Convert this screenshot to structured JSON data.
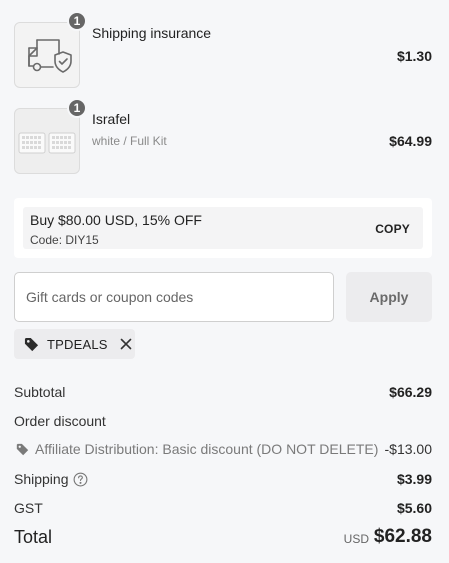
{
  "line_items": [
    {
      "name": "Shipping insurance",
      "variant": "",
      "price": "$1.30",
      "quantity": "1",
      "icon": "shipping-truck-shield-icon"
    },
    {
      "name": "Israfel",
      "variant": "white / Full Kit",
      "price": "$64.99",
      "quantity": "1",
      "icon": "product-thumbnail"
    }
  ],
  "offer": {
    "title": "Buy $80.00 USD, 15% OFF",
    "code_text": "Code: DIY15",
    "copy_label": "COPY"
  },
  "coupon": {
    "placeholder": "Gift cards or coupon codes",
    "value": "",
    "apply_label": "Apply"
  },
  "applied_tag": {
    "label": "TPDEALS",
    "icon": "tag-icon",
    "remove_icon": "close-icon"
  },
  "summary": {
    "subtotal_label": "Subtotal",
    "subtotal_value": "$66.29",
    "order_discount_label": "Order discount",
    "discount_name": "Affiliate Distribution: Basic discount (DO NOT DELETE)",
    "discount_value": "-$13.00",
    "shipping_label": "Shipping",
    "shipping_value": "$3.99",
    "gst_label": "GST",
    "gst_value": "$5.60",
    "total_label": "Total",
    "total_currency": "USD",
    "total_value": "$62.88"
  },
  "colors": {
    "background": "#f6f7f9",
    "badge": "#666666",
    "apply_button": "#ececee"
  }
}
